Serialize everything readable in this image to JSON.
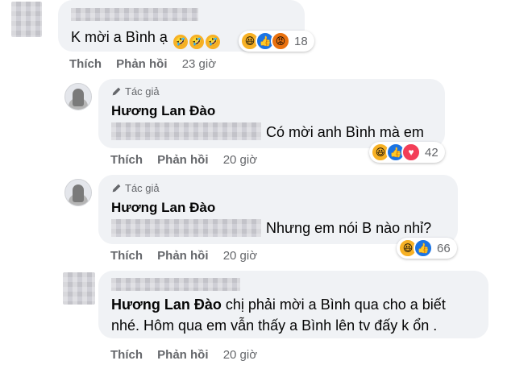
{
  "comments": [
    {
      "text": "K mời a Bình ạ",
      "inline_emojis": [
        "🤣",
        "🤣",
        "🤣"
      ],
      "reactions": {
        "icons": [
          "haha-icon",
          "like-icon",
          "angry-icon"
        ],
        "count": "18"
      },
      "actions": {
        "like": "Thích",
        "reply": "Phản hồi",
        "time": "23 giờ"
      }
    },
    {
      "badge": "Tác giả",
      "author": "Hương Lan Đào",
      "text": "Có mời anh Bình mà em",
      "reactions": {
        "icons": [
          "haha-icon",
          "like-icon",
          "love-icon"
        ],
        "count": "42"
      },
      "actions": {
        "like": "Thích",
        "reply": "Phản hồi",
        "time": "20 giờ"
      }
    },
    {
      "badge": "Tác giả",
      "author": "Hương Lan Đào",
      "text": "Nhưng em nói B nào nhỉ?",
      "reactions": {
        "icons": [
          "haha-icon",
          "like-icon"
        ],
        "count": "66"
      },
      "actions": {
        "like": "Thích",
        "reply": "Phản hồi",
        "time": "20 giờ"
      }
    },
    {
      "mention": "Hương Lan Đào",
      "text_line1": "chị phải mời a Bình qua cho a biết",
      "text_line2": "nhé. Hôm qua em vẫn thấy a Bình lên tv đấy k ổn .",
      "actions": {
        "like": "Thích",
        "reply": "Phản hồi",
        "time": "20 giờ"
      }
    }
  ],
  "colors": {
    "bubble": "#f0f2f5",
    "meta": "#65676b",
    "like": "#1b74e4",
    "love": "#f33e58",
    "haha": "#f7b125",
    "angry": "#e9710f"
  }
}
